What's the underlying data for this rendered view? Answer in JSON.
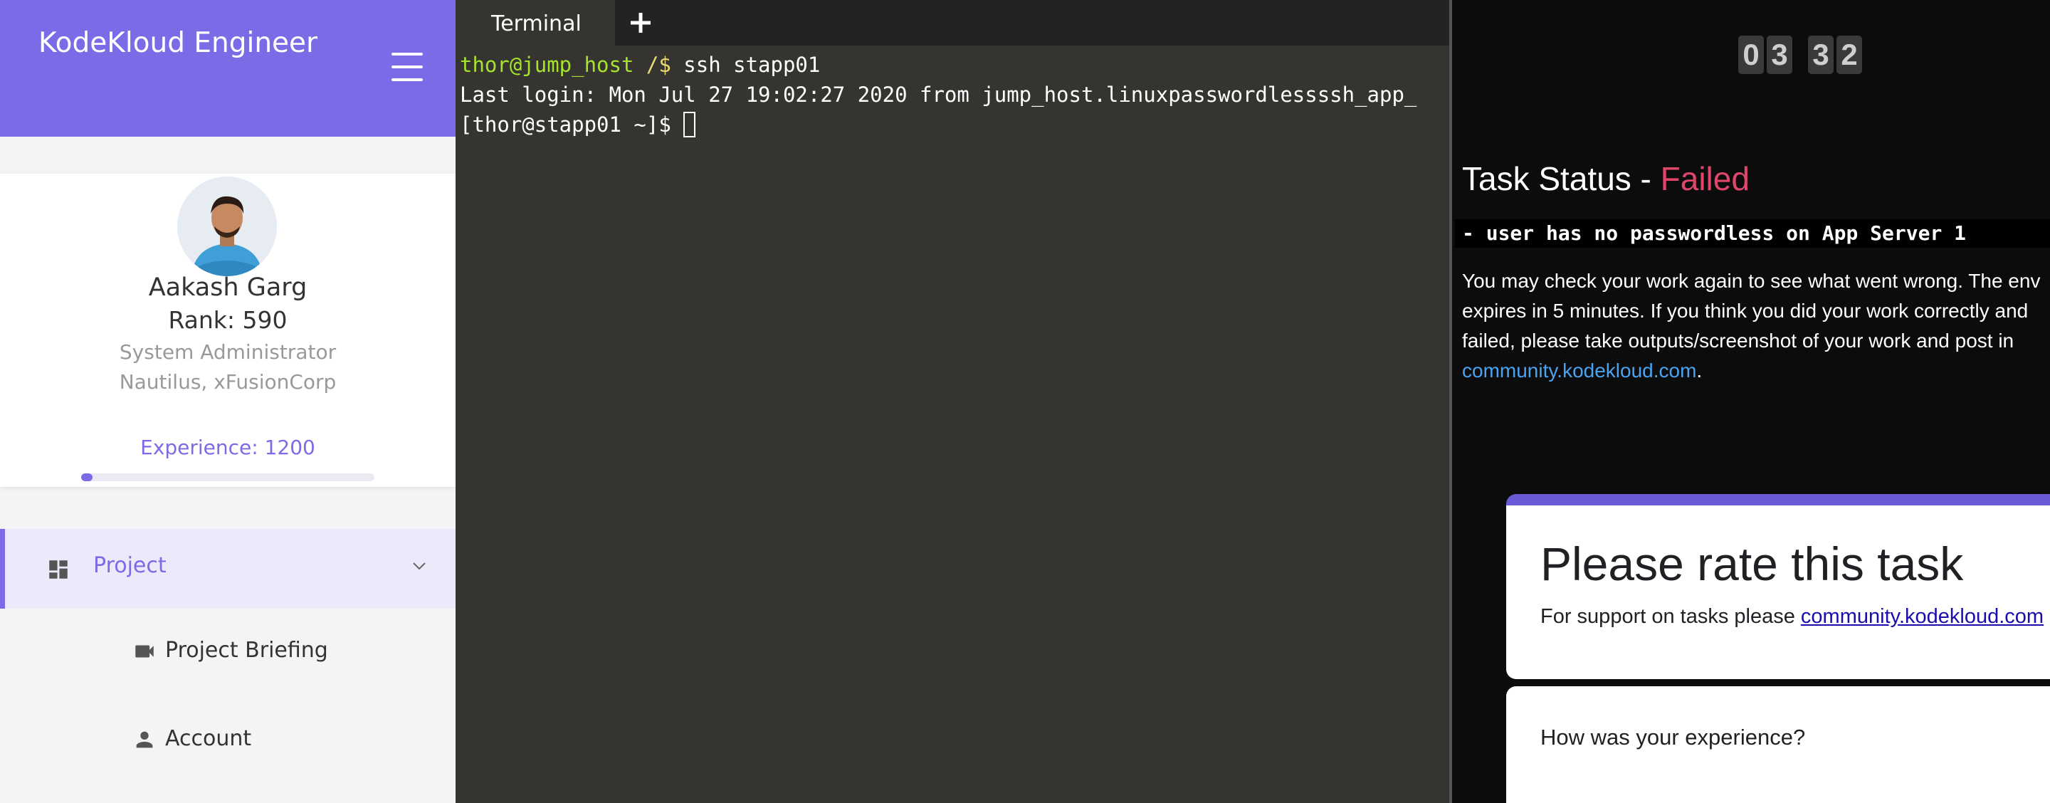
{
  "sidebar": {
    "brand": "KodeKloud Engineer",
    "profile": {
      "name": "Aakash Garg",
      "rank": "Rank: 590",
      "role": "System Administrator",
      "org": "Nautilus, xFusionCorp",
      "experience": "Experience: 1200",
      "experience_progress_fraction": 0.04
    },
    "nav": {
      "project": "Project",
      "project_briefing": "Project Briefing",
      "account": "Account"
    }
  },
  "terminal": {
    "tab_label": "Terminal",
    "lines": {
      "l1_user": "thor@jump_host",
      "l1_path": " /$",
      "l1_cmd": " ssh stapp01",
      "l2": "Last login: Mon Jul 27 19:02:27 2020 from jump_host.linuxpasswordlessssh_app_",
      "l3": "[thor@stapp01 ~]$ "
    }
  },
  "task": {
    "timer_digits": [
      "0",
      "3",
      "3",
      "2"
    ],
    "status_prefix": "Task Status - ",
    "status_value": "Failed",
    "message": "- user has no passwordless on App Server 1",
    "para_text": "You may check your work again to see what went wrong. The env\nexpires in 5 minutes. If you think you did your work correctly and\nfailed, please take outputs/screenshot of your work and post in\n",
    "para_link": "community.kodekloud.com",
    "para_end": "."
  },
  "rating": {
    "title": "Please rate this task",
    "support_prefix": "For support on tasks please ",
    "support_link": "community.kodekloud.com",
    "question": "How was your experience?"
  },
  "colors": {
    "accent": "#7b6be6",
    "terminal_bg": "#353430",
    "failed": "#e0456b",
    "link": "#4aa3f0"
  }
}
